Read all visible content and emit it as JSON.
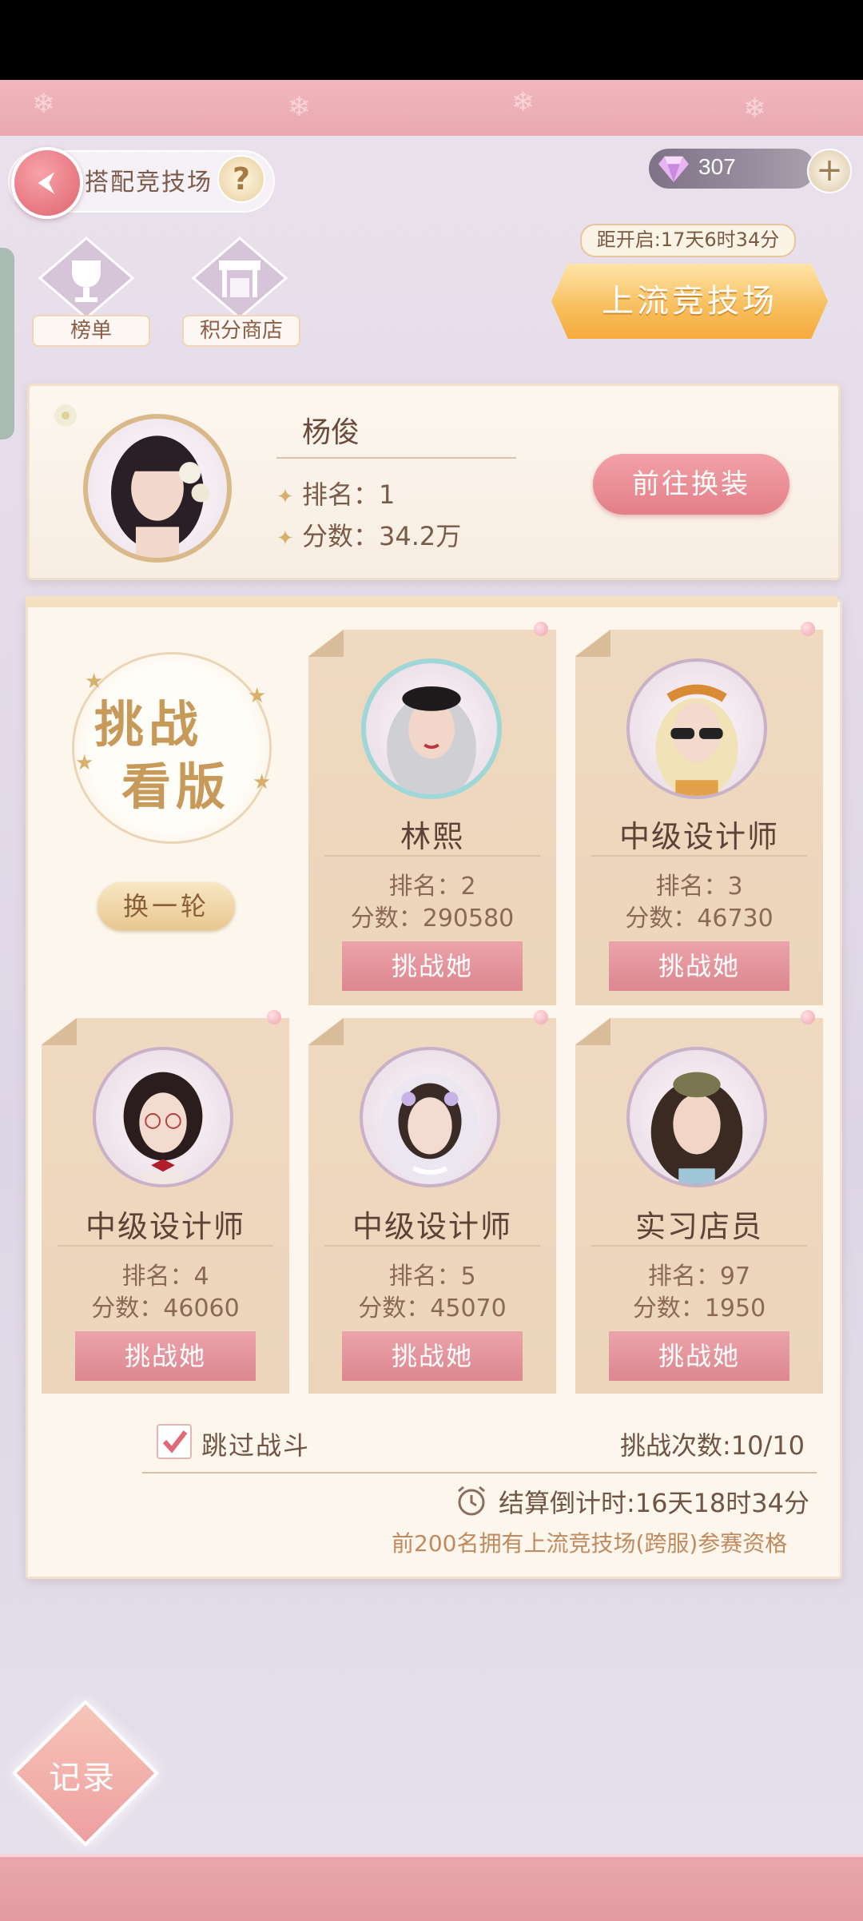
{
  "header": {
    "title": "搭配竞技场",
    "help_label": "?",
    "gems": "307",
    "plus_label": "+"
  },
  "top_icons": [
    {
      "label": "榜单",
      "icon": "trophy-icon"
    },
    {
      "label": "积分商店",
      "icon": "shop-icon"
    }
  ],
  "premium": {
    "open_time": "距开启:17天6时34分",
    "button_label": "上流竞技场"
  },
  "player": {
    "name": "杨俊",
    "rank_label": "排名：",
    "rank": "1",
    "score_label": "分数：",
    "score": "34.2万",
    "go_label": "前往换装"
  },
  "challenge": {
    "badge_line1": "挑战",
    "badge_line2": "看版",
    "refresh_label": "换一轮",
    "challenge_label": "挑战她",
    "opponents": [
      {
        "name": "林熙",
        "rank": "排名：2",
        "score": "分数：290580"
      },
      {
        "name": "中级设计师",
        "rank": "排名：3",
        "score": "分数：46730"
      },
      {
        "name": "中级设计师",
        "rank": "排名：4",
        "score": "分数：46060"
      },
      {
        "name": "中级设计师",
        "rank": "排名：5",
        "score": "分数：45070"
      },
      {
        "name": "实习店员",
        "rank": "排名：97",
        "score": "分数：1950"
      }
    ]
  },
  "footer": {
    "skip_label": "跳过战斗",
    "skip_checked": true,
    "attempts": "挑战次数:10/10",
    "countdown": "结算倒计时:16天18时34分",
    "note": "前200名拥有上流竞技场(跨服)参赛资格"
  },
  "record_label": "记录",
  "colors": {
    "accent_pink": "#e37f87",
    "gold": "#c79a5a",
    "panel": "#fdf6ec"
  }
}
